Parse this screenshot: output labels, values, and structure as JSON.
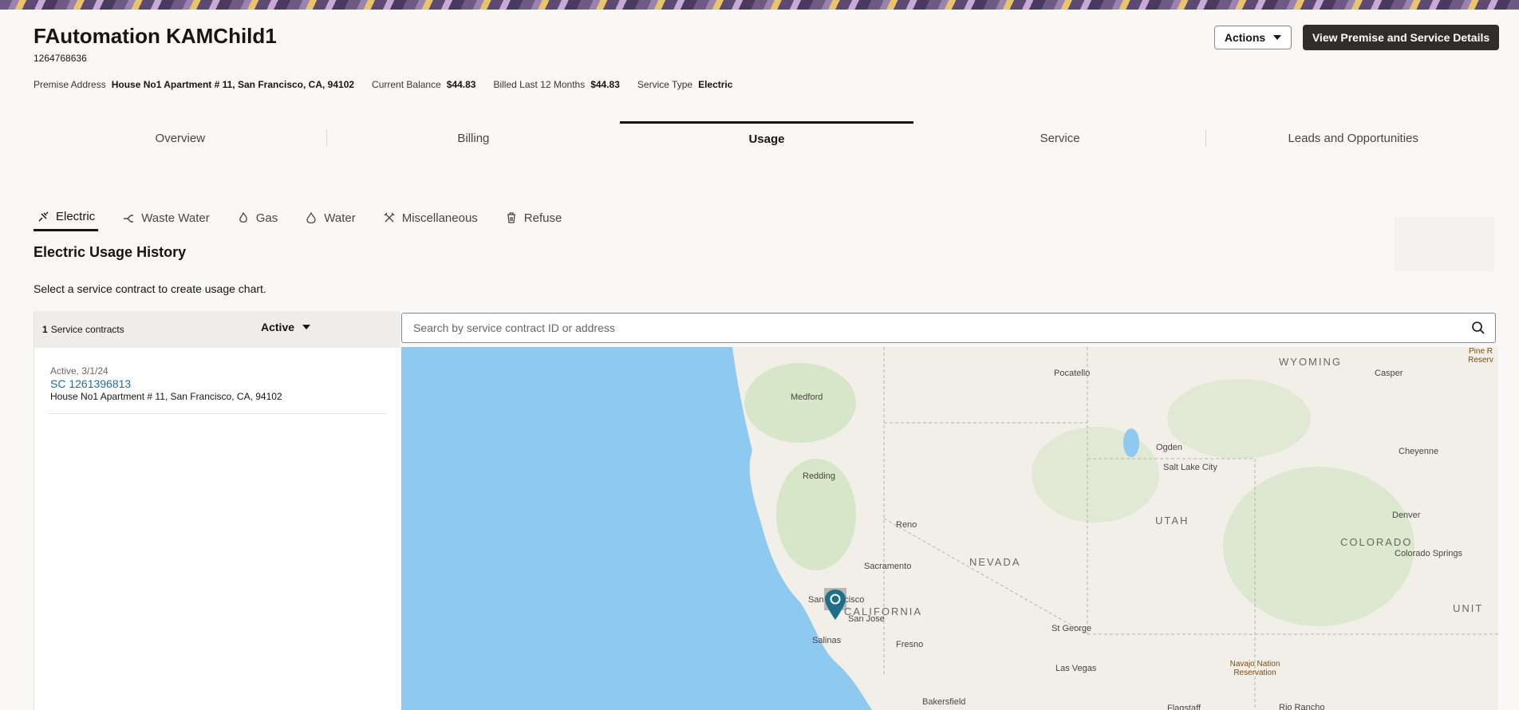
{
  "header": {
    "title": "FAutomation KAMChild1",
    "account_id": "1264768636",
    "actions_label": "Actions",
    "view_details_label": "View Premise and Service Details"
  },
  "info": {
    "premise_label": "Premise Address",
    "premise_value": "House No1 Apartment # 11, San Francisco, CA, 94102",
    "balance_label": "Current Balance",
    "balance_value": "$44.83",
    "billed_label": "Billed Last 12 Months",
    "billed_value": "$44.83",
    "service_type_label": "Service Type",
    "service_type_value": "Electric"
  },
  "tabs": [
    "Overview",
    "Billing",
    "Usage",
    "Service",
    "Leads and Opportunities"
  ],
  "active_tab": "Usage",
  "sub_tabs": [
    {
      "label": "Electric",
      "icon": "electric-plug-icon"
    },
    {
      "label": "Waste Water",
      "icon": "waste-water-icon"
    },
    {
      "label": "Gas",
      "icon": "gas-flame-icon"
    },
    {
      "label": "Water",
      "icon": "water-drop-icon"
    },
    {
      "label": "Miscellaneous",
      "icon": "tools-icon"
    },
    {
      "label": "Refuse",
      "icon": "trash-icon"
    }
  ],
  "section": {
    "title": "Electric Usage History",
    "hint": "Select a service contract to create usage chart."
  },
  "contracts_panel": {
    "count": "1",
    "count_label": "Service contracts",
    "filter_label": "Active",
    "items": [
      {
        "status": "Active, 3/1/24",
        "id": "SC 1261396813",
        "address": "House No1 Apartment # 11, San Francisco, CA, 94102"
      }
    ]
  },
  "search": {
    "placeholder": "Search by service contract ID or address"
  },
  "map": {
    "labels": {
      "medford": "Medford",
      "redding": "Redding",
      "reno": "Reno",
      "sacramento": "Sacramento",
      "san_francisco": "San Francisco",
      "san_jose": "San Jose",
      "california": "CALIFORNIA",
      "salinas": "Salinas",
      "fresno": "Fresno",
      "bakersfield": "Bakersfield",
      "nevada": "NEVADA",
      "pocatello": "Pocatello",
      "wyoming": "WYOMING",
      "casper": "Casper",
      "ogden": "Ogden",
      "salt_lake_city": "Salt Lake City",
      "cheyenne": "Cheyenne",
      "utah": "UTAH",
      "denver": "Denver",
      "colorado": "COLORADO",
      "colorado_springs": "Colorado Springs",
      "st_george": "St George",
      "las_vegas": "Las Vegas",
      "navajo": "Navajo Nation Reservation",
      "pine_ridge": "Pine R Reserv",
      "united": "UNIT",
      "flagstaff": "Flagstaff",
      "rio_rancho": "Rio Rancho"
    },
    "colors": {
      "ocean": "#8ec9ef",
      "land": "#f2efe9",
      "park": "#cfe3bf",
      "pin": "#1f6f8b"
    }
  }
}
